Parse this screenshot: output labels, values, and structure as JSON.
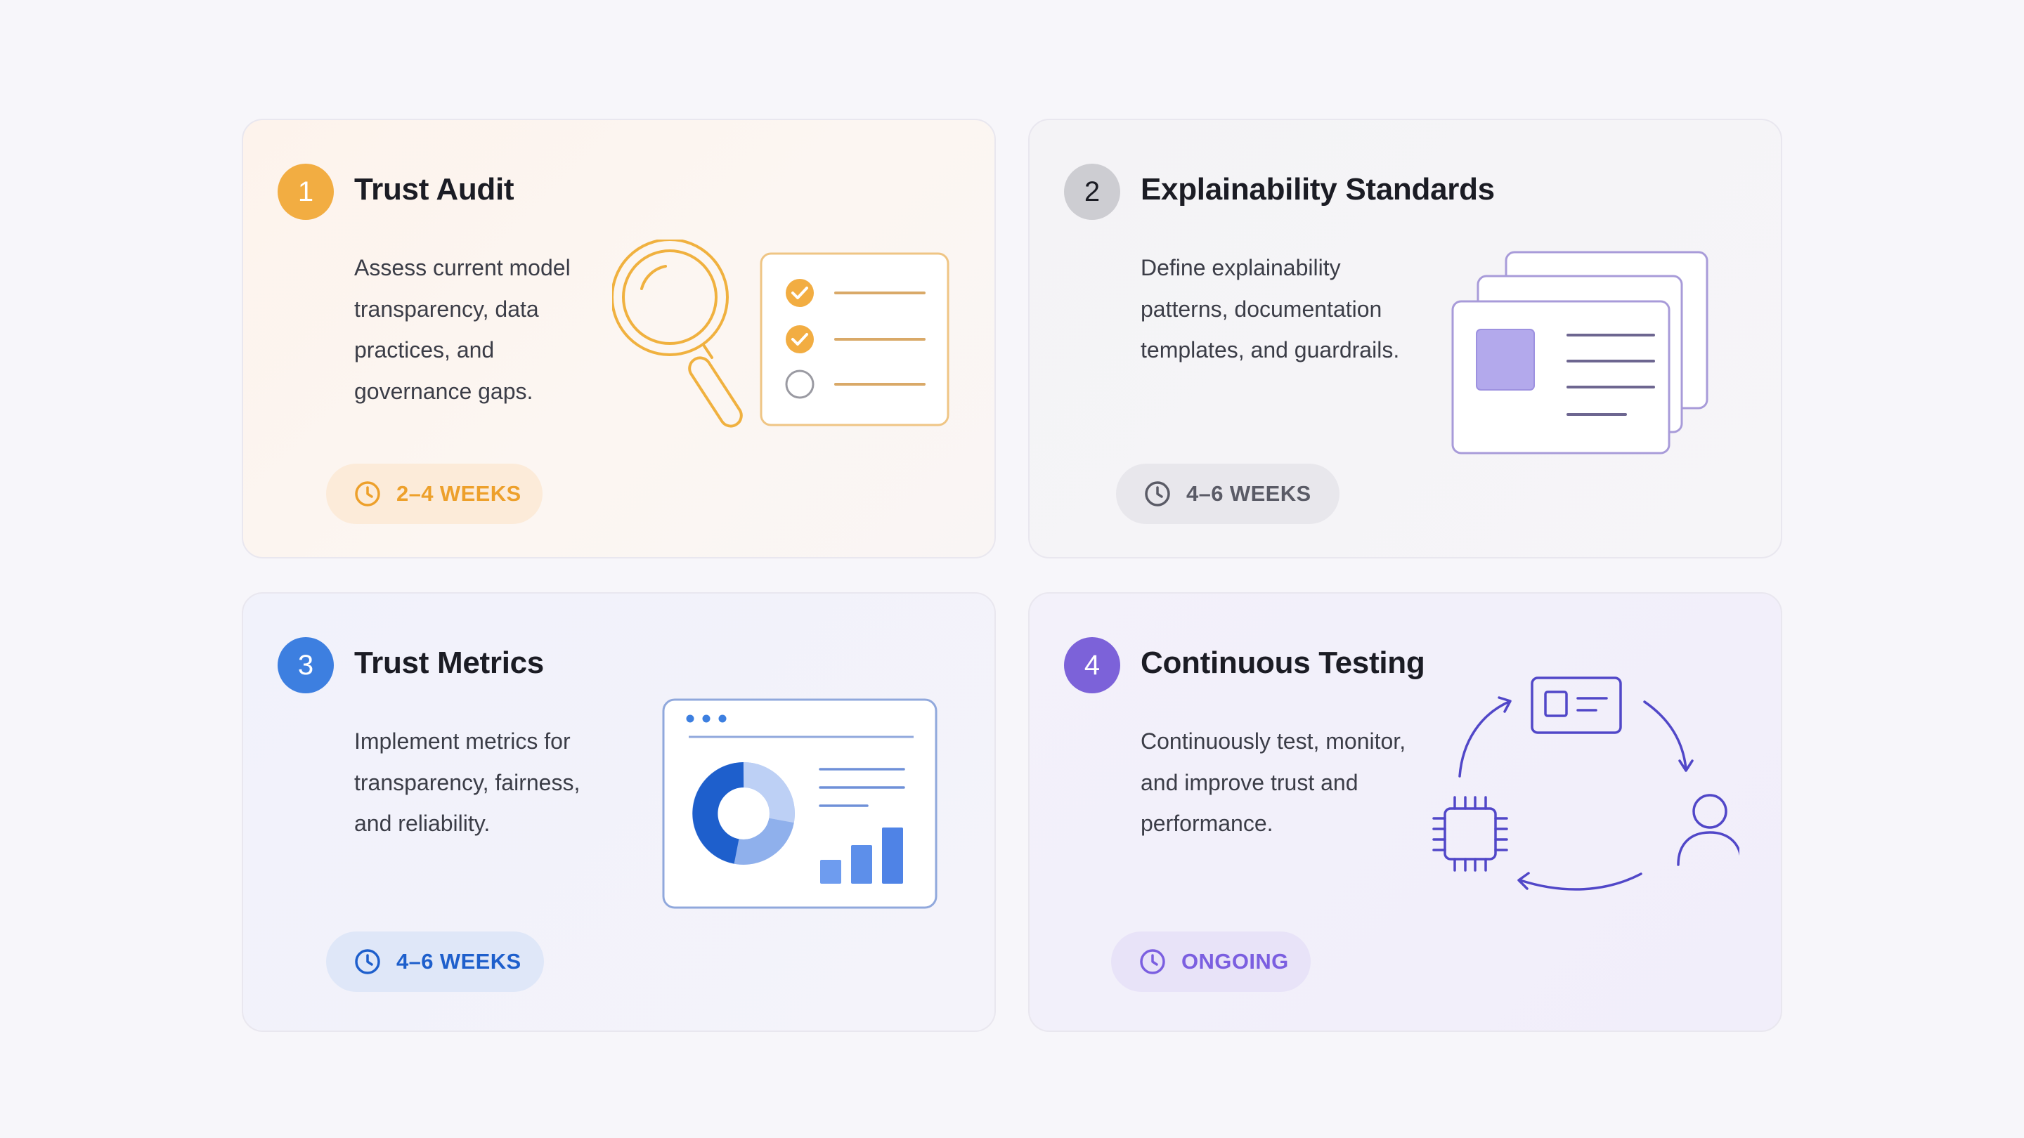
{
  "cards": [
    {
      "number": "1",
      "title": "Trust Audit",
      "description": "Assess current model transparency, data practices, and governance gaps.",
      "duration": "2–4 WEEKS",
      "accent": "#f2ad42",
      "pill_bg": "#fcebd9",
      "pill_text": "#eda02b",
      "illustration_icon": "magnifier-checklist-icon"
    },
    {
      "number": "2",
      "title": "Explainability Standards",
      "description": "Define explainability patterns, documentation templates, and guardrails.",
      "duration": "4–6 WEEKS",
      "accent": "#cdcdd2",
      "pill_bg": "#e8e7ec",
      "pill_text": "#5a5b66",
      "illustration_icon": "stacked-documents-icon"
    },
    {
      "number": "3",
      "title": "Trust Metrics",
      "description": "Implement metrics for transparency, fairness, and reliability.",
      "duration": "4–6 WEEKS",
      "accent": "#3d7fe0",
      "pill_bg": "#dfe7f8",
      "pill_text": "#1e5fcc",
      "illustration_icon": "dashboard-chart-icon"
    },
    {
      "number": "4",
      "title": "Continuous Testing",
      "description": "Continuously test, monitor, and improve trust and performance.",
      "duration": "ONGOING",
      "accent": "#7c62d9",
      "pill_bg": "#e8e3f8",
      "pill_text": "#7b5fe0",
      "illustration_icon": "cycle-chip-person-icon"
    }
  ]
}
